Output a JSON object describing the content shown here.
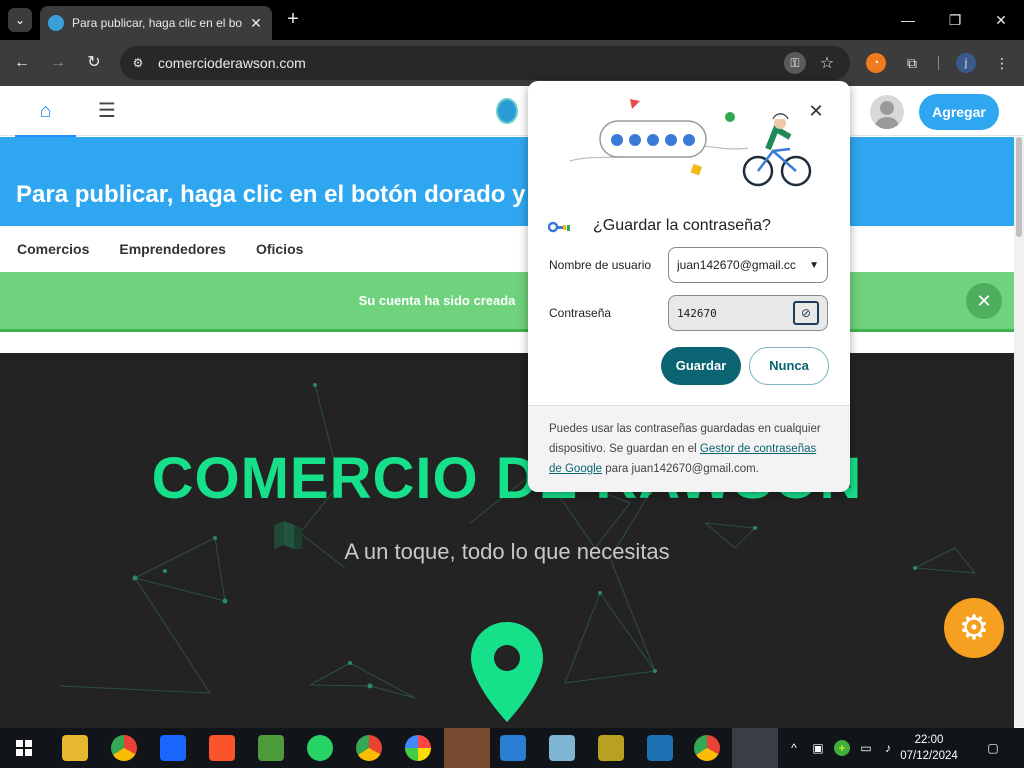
{
  "browser": {
    "tab_title": "Para publicar, haga clic en el bo",
    "url": "comercioderawson.com",
    "profile_initial": "j"
  },
  "site": {
    "nav_button": "Agregar",
    "banner": "Para publicar, haga clic en el botón dorado y a",
    "categories": [
      "Comercios",
      "Emprendedores",
      "Oficios"
    ],
    "alert": "Su cuenta ha sido creada",
    "hero_title": "COMERCIO DE RAWSON",
    "hero_subtitle": "A un toque, todo lo que necesitas"
  },
  "password_prompt": {
    "title": "¿Guardar la contraseña?",
    "username_label": "Nombre de usuario",
    "username_value": "juan142670@gmail.cc",
    "password_label": "Contraseña",
    "password_value": "142670",
    "save_label": "Guardar",
    "never_label": "Nunca",
    "footer_text_1": "Puedes usar las contraseñas guardadas en cualquier dispositivo. Se guardan en el ",
    "footer_link": "Gestor de contraseñas de Google",
    "footer_text_2": " para juan142670@gmail.com."
  },
  "taskbar": {
    "time": "22:00",
    "date": "07/12/2024"
  },
  "colors": {
    "banner": "#2ea7f0",
    "alert": "#6fd27c",
    "hero_title": "#17e08a",
    "save_button": "#0b6472",
    "gear_fab": "#f5a021"
  }
}
